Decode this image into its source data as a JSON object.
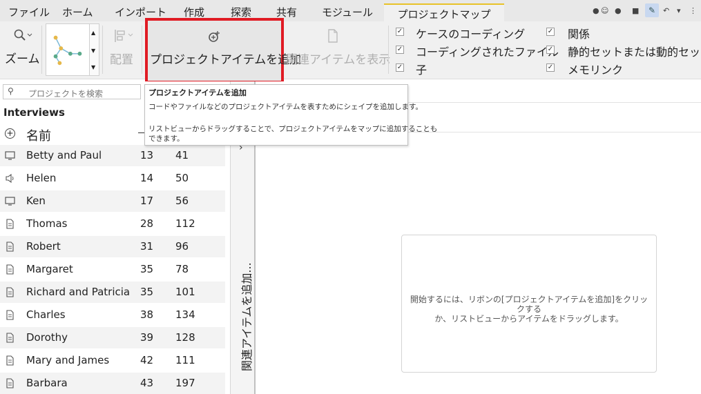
{
  "tabs": [
    "ファイル",
    "ホーム",
    "インポート",
    "作成",
    "探索",
    "共有",
    "モジュール"
  ],
  "active_tab": "プロジェクトマップ",
  "accent_color": "#e8c227",
  "highlight_color": "#e01b24",
  "ribbon": {
    "zoom_label": "ズーム",
    "layout_label": "配置",
    "add_item_label": "プロジェクトアイテムを追加",
    "show_related_label": "関連アイテムを表示",
    "checkboxes_left": [
      "ケースのコーディング",
      "コーディングされたファイル",
      "子"
    ],
    "checkboxes_right": [
      "関係",
      "静的セットまたは動的セット",
      "メモリンク"
    ]
  },
  "search": {
    "placeholder": "プロジェクトを検索"
  },
  "list": {
    "group_title": "Interviews",
    "name_header": "名前",
    "rows": [
      {
        "name": "Betty and Paul",
        "icon": "video-icon",
        "c1": "13",
        "c2": "41"
      },
      {
        "name": "Helen",
        "icon": "audio-icon",
        "c1": "14",
        "c2": "50"
      },
      {
        "name": "Ken",
        "icon": "video-icon",
        "c1": "17",
        "c2": "56"
      },
      {
        "name": "Thomas",
        "icon": "document-icon",
        "c1": "28",
        "c2": "112"
      },
      {
        "name": "Robert",
        "icon": "document-icon",
        "c1": "31",
        "c2": "96"
      },
      {
        "name": "Margaret",
        "icon": "document-icon",
        "c1": "35",
        "c2": "78"
      },
      {
        "name": "Richard and Patricia",
        "icon": "document-icon",
        "c1": "35",
        "c2": "101"
      },
      {
        "name": "Charles",
        "icon": "document-icon",
        "c1": "38",
        "c2": "134"
      },
      {
        "name": "Dorothy",
        "icon": "document-icon",
        "c1": "39",
        "c2": "128"
      },
      {
        "name": "Mary and James",
        "icon": "document-icon",
        "c1": "42",
        "c2": "111"
      },
      {
        "name": "Barbara",
        "icon": "document-icon",
        "c1": "43",
        "c2": "197"
      }
    ]
  },
  "related_panel": {
    "label": "関連アイテムを追加..."
  },
  "tooltip": {
    "title": "プロジェクトアイテムを追加",
    "line1": "コードやファイルなどのプロジェクトアイテムを表すためにシェイプを追加します。",
    "line2": "リストビューからドラッグすることで、プロジェクトアイテムをマップに追加することも",
    "line3": "できます。"
  },
  "canvas": {
    "hint_line1": "開始するには、リボンの[プロジェクトアイテムを追加]をクリックする",
    "hint_line2": "か、リストビューからアイテムをドラッグします。"
  }
}
